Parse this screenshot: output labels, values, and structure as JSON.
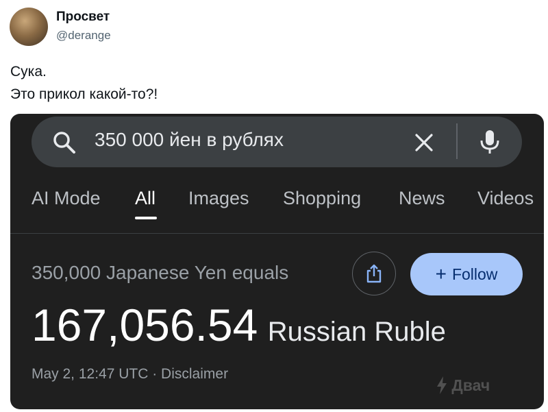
{
  "author": {
    "name": "Просвет",
    "handle": "@derange"
  },
  "tweet": {
    "line1": "Сука.",
    "line2": "Это прикол какой-то?!"
  },
  "screenshot": {
    "search": {
      "query": "350 000 йен в рублях"
    },
    "tabs": [
      {
        "label": "AI Mode"
      },
      {
        "label": "All",
        "active": true
      },
      {
        "label": "Images"
      },
      {
        "label": "Shopping"
      },
      {
        "label": "News"
      },
      {
        "label": "Videos"
      }
    ],
    "converter": {
      "label": "350,000 Japanese Yen equals",
      "amount": "167,056.54",
      "currency": "Russian Ruble",
      "meta": "May 2, 12:47 UTC · Disclaimer",
      "follow_label": "Follow"
    },
    "watermark": "Двач"
  },
  "colors": {
    "background": "#1f1f1f",
    "search_bar": "#3c4043",
    "follow_button": "#a8c7fa"
  },
  "icons": [
    "search-icon",
    "clear-icon",
    "mic-icon",
    "share-icon",
    "plus-icon",
    "lightning-icon"
  ]
}
